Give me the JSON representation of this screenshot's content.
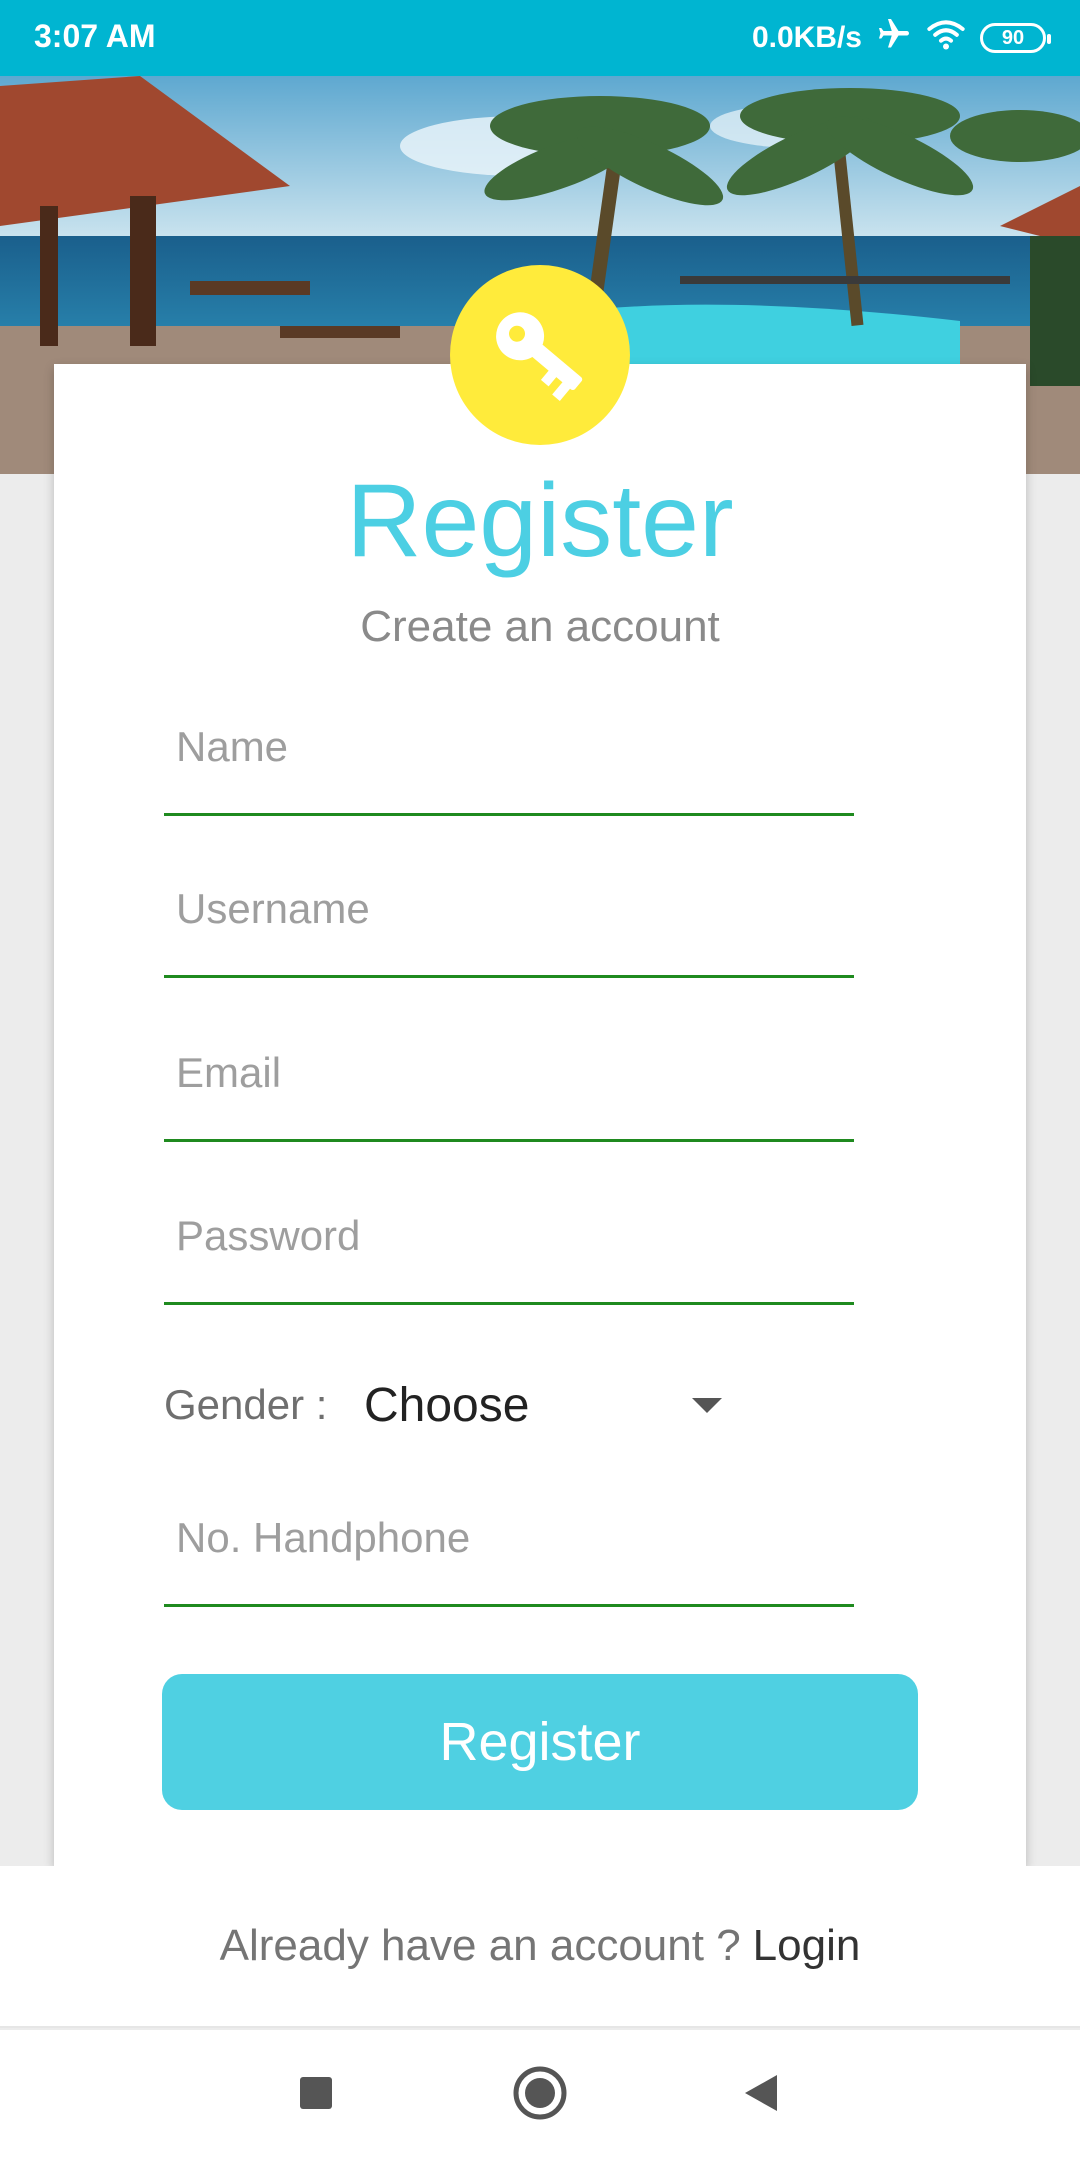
{
  "status_bar": {
    "time": "3:07 AM",
    "network_speed": "0.0KB/s",
    "battery_level": "90",
    "icons": [
      "airplane-icon",
      "wifi-icon",
      "battery-icon"
    ]
  },
  "hero": {
    "image": "beach-resort-pool-photo"
  },
  "header": {
    "icon": "key-icon",
    "title": "Register",
    "subtitle": "Create an account"
  },
  "form": {
    "name_placeholder": "Name",
    "username_placeholder": "Username",
    "email_placeholder": "Email",
    "password_placeholder": "Password",
    "gender_label": "Gender :",
    "gender_value": "Choose",
    "phone_placeholder": "No. Handphone",
    "register_label": "Register"
  },
  "footer": {
    "prompt": "Already have an account ?",
    "login_label": "Login"
  },
  "colors": {
    "accent": "#4fd0e2",
    "status_bar": "#00b5d1",
    "key_badge": "#ffeb3b",
    "field_underline": "#1f8a1f"
  }
}
